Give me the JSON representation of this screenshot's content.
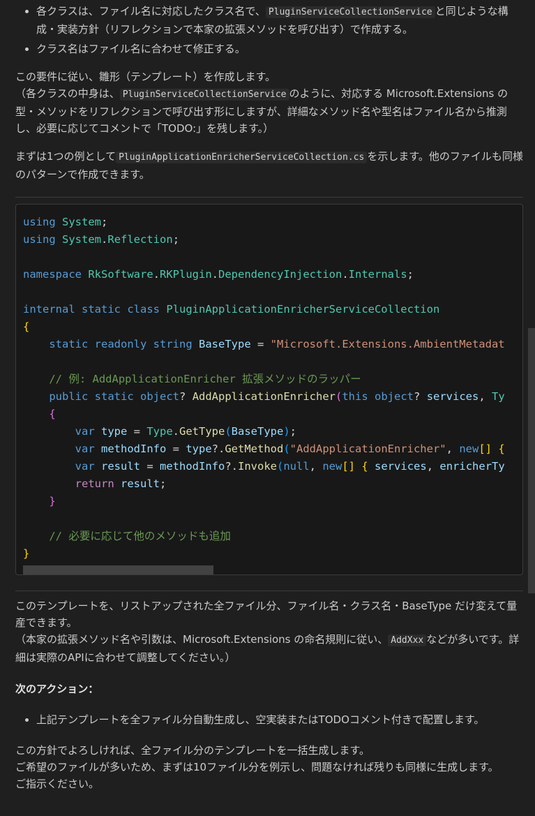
{
  "intro_bullets": [
    {
      "pre": "各クラスは、ファイル名に対応したクラス名で、",
      "code": "PluginServiceCollectionService",
      "post": "と同じような構成・実装方針（リフレクションで本家の拡張メソッドを呼び出す）で作成する。"
    },
    {
      "text": "クラス名はファイル名に合わせて修正する。"
    }
  ],
  "para1": {
    "line1": "この要件に従い、雛形（テンプレート）を作成します。",
    "line2_pre": "（各クラスの中身は、",
    "line2_code": "PluginServiceCollectionService",
    "line2_post": "のように、対応する Microsoft.Extensions の型・メソッドをリフレクションで呼び出す形にしますが、詳細なメソッド名や型名はファイル名から推測し、必要に応じてコメントで「TODO:」を残します。）"
  },
  "para2": {
    "pre": "まずは1つの例として",
    "code": "PluginApplicationEnricherServiceCollection.cs",
    "post": "を示します。他のファイルも同様のパターンで作成できます。"
  },
  "code": {
    "using": "using",
    "system": "System",
    "reflection": "Reflection",
    "namespace_kw": "namespace",
    "ns1": "RkSoftware",
    "ns2": "RKPlugin",
    "ns3": "DependencyInjection",
    "ns4": "Internals",
    "internal": "internal",
    "static": "static",
    "class": "class",
    "class_name": "PluginApplicationEnricherServiceCollection",
    "readonly": "readonly",
    "string": "string",
    "base_type": "BaseType",
    "base_type_value": "\"Microsoft.Extensions.AmbientMetadat",
    "comment1": "// 例: AddApplicationEnricher 拡張メソッドのラッパー",
    "public": "public",
    "object": "object",
    "method_name": "AddApplicationEnricher",
    "this": "this",
    "services": "services",
    "param_tail": "Ty",
    "var": "var",
    "type_var": "type",
    "type_class": "Type",
    "get_type": "GetType",
    "method_info": "methodInfo",
    "get_method": "GetMethod",
    "method_str": "\"AddApplicationEnricher\"",
    "new": "new",
    "result": "result",
    "invoke": "Invoke",
    "null": "null",
    "enricher_tail": "enricherTy",
    "return": "return",
    "comment2": "// 必要に応じて他のメソッドも追加"
  },
  "para3": {
    "line1": "このテンプレートを、リストアップされた全ファイル分、ファイル名・クラス名・BaseType だけ変えて量産できます。",
    "line2_pre": "（本家の拡張メソッド名や引数は、Microsoft.Extensions の命名規則に従い、",
    "line2_code": "AddXxx",
    "line2_post": "などが多いです。詳細は実際のAPIに合わせて調整してください。）"
  },
  "next_action_heading": "次のアクション：",
  "next_action_items": [
    "上記テンプレートを全ファイル分自動生成し、空実装またはTODOコメント付きで配置します。"
  ],
  "closing": {
    "line1": "この方針でよろしければ、全ファイル分のテンプレートを一括生成します。",
    "line2": "ご希望のファイルが多いため、まずは10ファイル分を例示し、問題なければ残りも同様に生成します。",
    "line3": "ご指示ください。"
  }
}
